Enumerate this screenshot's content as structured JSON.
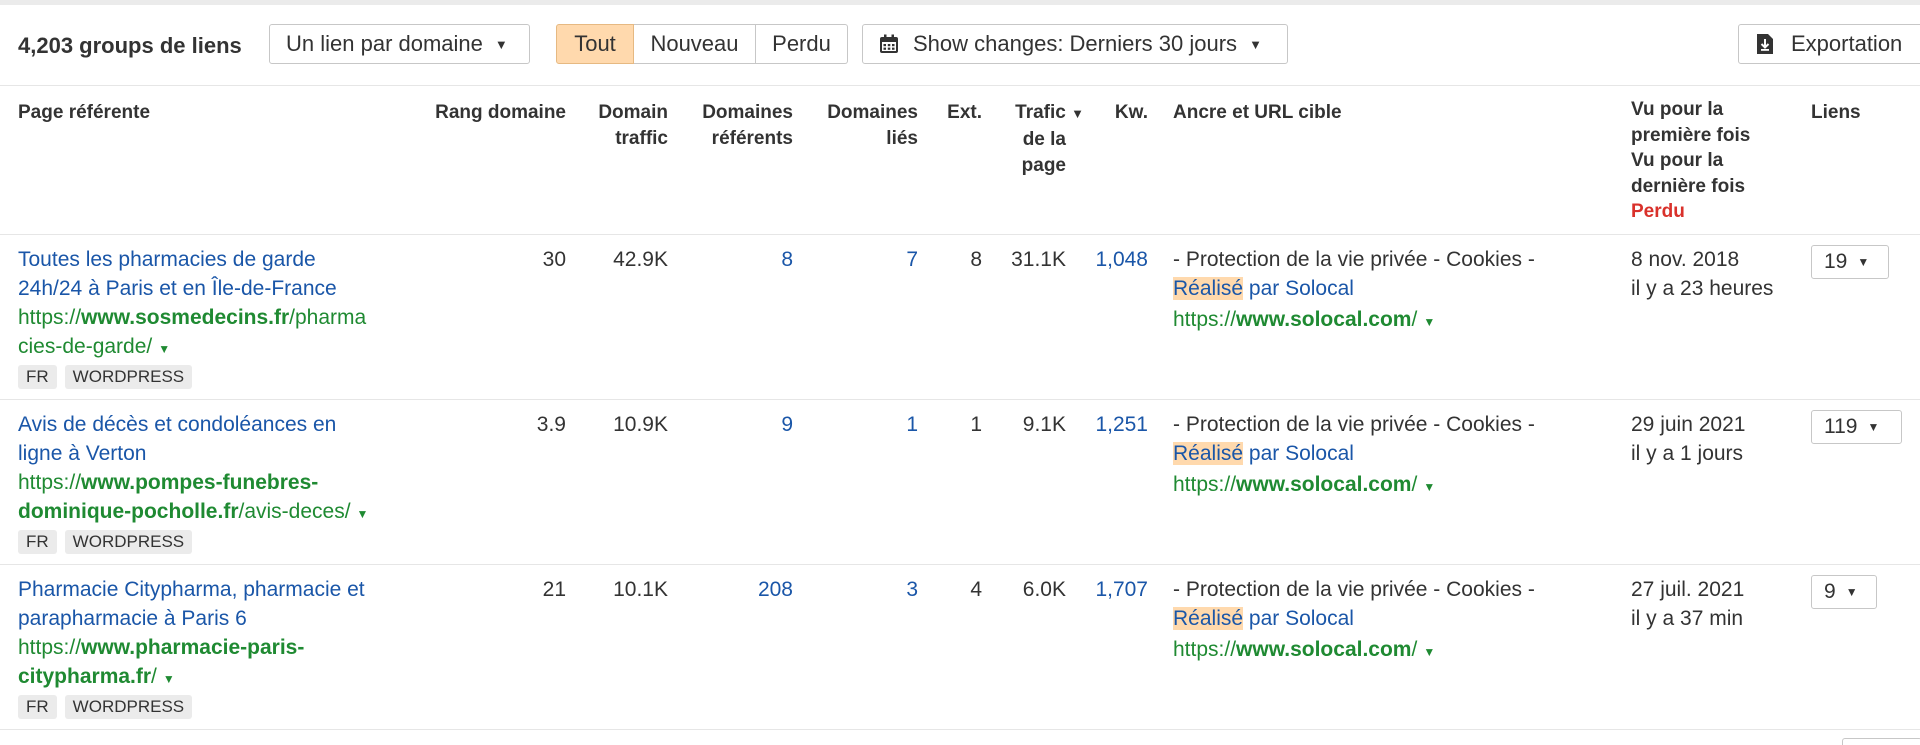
{
  "toolbar": {
    "count_label": "4,203 groups de liens",
    "domain_filter": "Un lien par domaine",
    "segments": [
      "Tout",
      "Nouveau",
      "Perdu"
    ],
    "active_segment": "Tout",
    "changes_label": "Show changes: Derniers 30 jours",
    "export_label": "Exportation"
  },
  "colors": {
    "accent_active": "#ffd9ad",
    "link": "#1a56a8",
    "url": "#1f8a32",
    "lost": "#d9312b"
  },
  "columns": {
    "page": "Page référente",
    "dr": "Rang domaine",
    "traffic": [
      "Domain",
      "traffic"
    ],
    "ref_domains": [
      "Domaines",
      "référents"
    ],
    "linked_domains": [
      "Domaines",
      "liés"
    ],
    "ext": "Ext.",
    "page_traffic": [
      "Trafic",
      "de la",
      "page"
    ],
    "kw": "Kw.",
    "anchor": "Ancre et URL cible",
    "seen": [
      "Vu pour la",
      "première fois",
      "Vu pour la",
      "dernière fois"
    ],
    "seen_lost": "Perdu",
    "links": "Liens"
  },
  "rows": [
    {
      "title": [
        "Toutes les pharmacies de garde",
        "24h/24 à Paris et en Île-de-France"
      ],
      "url": [
        {
          "pre": "https://",
          "bold": "www.sosmedecins.fr",
          "post": "/pharma"
        },
        {
          "pre": "cies-de-garde/",
          "bold": "",
          "post": ""
        }
      ],
      "tags": [
        "FR",
        "WORDPRESS"
      ],
      "dr": "30",
      "traffic": "42.9K",
      "ref_domains": "8",
      "linked_domains": "7",
      "ext": "8",
      "page_traffic": "31.1K",
      "kw": "1,048",
      "anchor_line1": "- Protection de la vie privée - Cookies -",
      "anchor_hl": "Réalisé",
      "anchor_rest": "par Solocal",
      "target_pre": "https://",
      "target_bold": "www.solocal.com",
      "target_post": "/",
      "first_seen": "8 nov. 2018",
      "last_seen": "il y a 23 heures",
      "links": "19"
    },
    {
      "title": [
        "Avis de décès et condoléances en",
        "ligne à Verton"
      ],
      "url": [
        {
          "pre": "https://",
          "bold": "www.pompes-funebres-",
          "post": ""
        },
        {
          "pre": "",
          "bold": "dominique-pocholle.fr",
          "post": "/avis-deces/"
        }
      ],
      "tags": [
        "FR",
        "WORDPRESS"
      ],
      "dr": "3.9",
      "traffic": "10.9K",
      "ref_domains": "9",
      "linked_domains": "1",
      "ext": "1",
      "page_traffic": "9.1K",
      "kw": "1,251",
      "anchor_line1": "- Protection de la vie privée - Cookies -",
      "anchor_hl": "Réalisé",
      "anchor_rest": "par Solocal",
      "target_pre": "https://",
      "target_bold": "www.solocal.com",
      "target_post": "/",
      "first_seen": "29 juin 2021",
      "last_seen": "il y a 1 jours",
      "links": "119"
    },
    {
      "title": [
        "Pharmacie Citypharma, pharmacie et",
        "parapharmacie à Paris 6"
      ],
      "url": [
        {
          "pre": "https://",
          "bold": "www.pharmacie-paris-",
          "post": ""
        },
        {
          "pre": "",
          "bold": "citypharma.fr",
          "post": "/"
        }
      ],
      "tags": [
        "FR",
        "WORDPRESS"
      ],
      "dr": "21",
      "traffic": "10.1K",
      "ref_domains": "208",
      "linked_domains": "3",
      "ext": "4",
      "page_traffic": "6.0K",
      "kw": "1,707",
      "anchor_line1": "- Protection de la vie privée - Cookies -",
      "anchor_hl": "Réalisé",
      "anchor_rest": "par Solocal",
      "target_pre": "https://",
      "target_bold": "www.solocal.com",
      "target_post": "/",
      "first_seen": "27 juil. 2021",
      "last_seen": "il y a 37 min",
      "links": "9"
    }
  ]
}
